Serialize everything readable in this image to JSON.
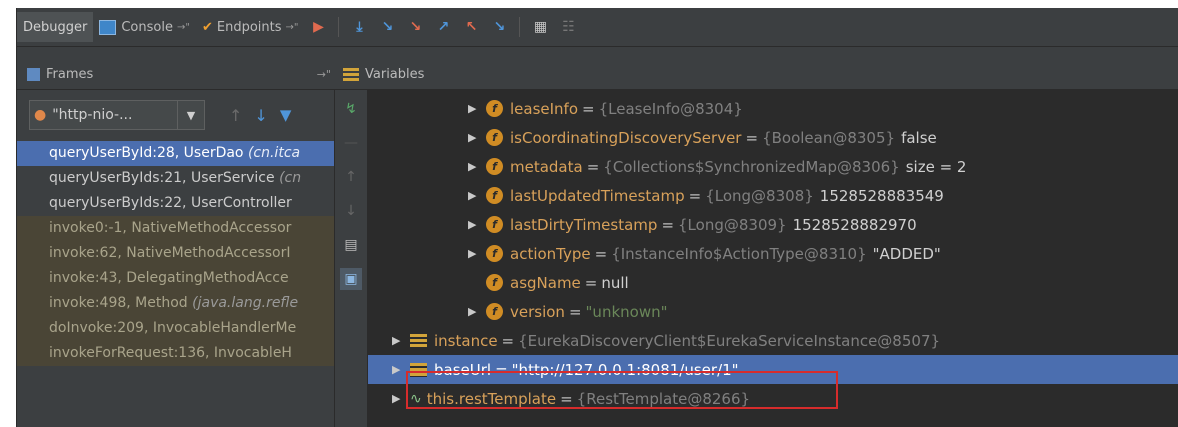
{
  "toolbar": {
    "tabs": [
      {
        "label": "Debugger",
        "active": true
      },
      {
        "label": "Console",
        "active": false
      },
      {
        "label": "Endpoints",
        "active": false
      }
    ],
    "buttons": [
      "show-execution-point-icon",
      "step-over-icon",
      "step-into-icon",
      "force-step-into-icon",
      "step-out-icon",
      "drop-frame-icon",
      "run-to-cursor-icon",
      "evaluate-expression-icon",
      "trace-icon"
    ]
  },
  "frames_panel": {
    "title": "Frames",
    "thread": "\"http-nio-...",
    "frames": [
      {
        "method": "queryUserById:28, UserDao",
        "pkg": "(cn.itca",
        "kind": "sel"
      },
      {
        "method": "queryUserByIds:21, UserService",
        "pkg": "(cn",
        "kind": "user"
      },
      {
        "method": "queryUserByIds:22, UserController",
        "pkg": "",
        "kind": "user"
      },
      {
        "method": "invoke0:-1, NativeMethodAccessor",
        "pkg": "",
        "kind": "lib"
      },
      {
        "method": "invoke:62, NativeMethodAccessorI",
        "pkg": "",
        "kind": "lib"
      },
      {
        "method": "invoke:43, DelegatingMethodAcce",
        "pkg": "",
        "kind": "lib"
      },
      {
        "method": "invoke:498, Method",
        "pkg": "(java.lang.refle",
        "kind": "lib"
      },
      {
        "method": "doInvoke:209, InvocableHandlerMe",
        "pkg": "",
        "kind": "lib"
      },
      {
        "method": "invokeForRequest:136, InvocableH",
        "pkg": "",
        "kind": "lib"
      }
    ]
  },
  "variables_panel": {
    "title": "Variables",
    "rows": [
      {
        "name": "leaseInfo",
        "ref": "{LeaseInfo@8304}",
        "value": "",
        "icon": "f",
        "arrow": true,
        "indent": 1
      },
      {
        "name": "isCoordinatingDiscoveryServer",
        "ref": "{Boolean@8305}",
        "value": "false",
        "icon": "f",
        "arrow": true,
        "indent": 1
      },
      {
        "name": "metadata",
        "ref": "{Collections$SynchronizedMap@8306}",
        "value": " size = 2",
        "icon": "f",
        "arrow": true,
        "indent": 1
      },
      {
        "name": "lastUpdatedTimestamp",
        "ref": "{Long@8308}",
        "value": "1528528883549",
        "icon": "f",
        "arrow": true,
        "indent": 1
      },
      {
        "name": "lastDirtyTimestamp",
        "ref": "{Long@8309}",
        "value": "1528528882970",
        "icon": "f",
        "arrow": true,
        "indent": 1
      },
      {
        "name": "actionType",
        "ref": "{InstanceInfo$ActionType@8310}",
        "value": "\"ADDED\"",
        "icon": "f",
        "arrow": true,
        "indent": 1
      },
      {
        "name": "asgName",
        "ref": "",
        "value": "null",
        "icon": "f",
        "arrow": false,
        "indent": 1
      },
      {
        "name": "version",
        "ref": "",
        "value": "\"unknown\"",
        "icon": "f",
        "arrow": true,
        "indent": 1
      },
      {
        "name": "instance",
        "ref": "{EurekaDiscoveryClient$EurekaServiceInstance@8507}",
        "value": "",
        "icon": "l",
        "arrow": true,
        "indent": 0
      },
      {
        "name": "baseUrl",
        "ref": "",
        "value": "\"http://127.0.0.1:8081/user/1\"",
        "icon": "l",
        "arrow": true,
        "indent": 0,
        "selected": true
      },
      {
        "name": "this.restTemplate",
        "ref": "{RestTemplate@8266}",
        "value": "",
        "icon": "t",
        "arrow": true,
        "indent": 0
      }
    ]
  },
  "colors": {
    "accent": "#4b6eaf",
    "highlight_border": "#d62c2c"
  }
}
